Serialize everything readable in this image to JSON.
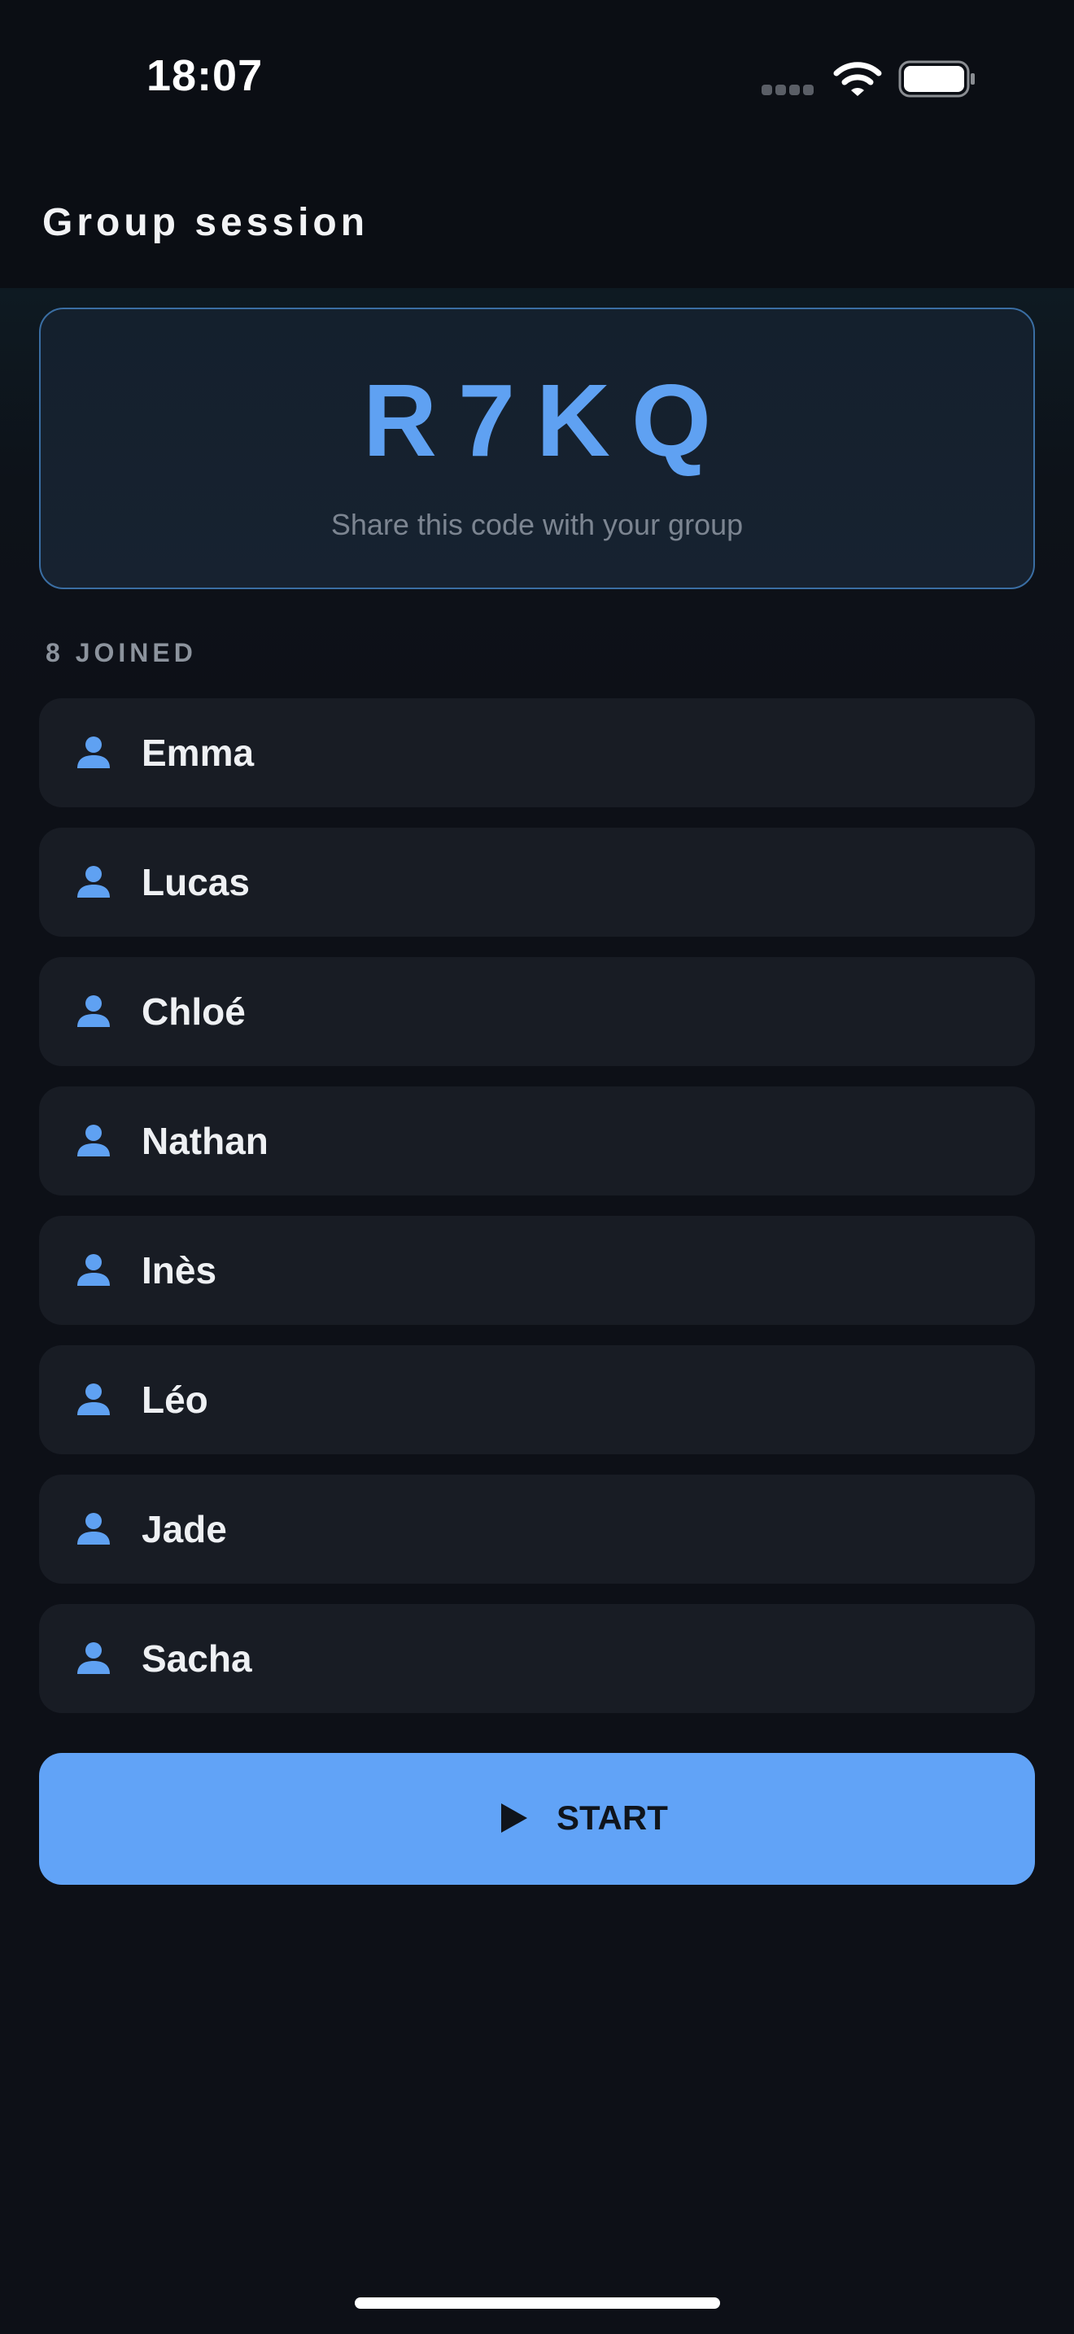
{
  "status_bar": {
    "time": "18:07",
    "signal_icon": "cellular-signal-icon",
    "wifi_icon": "wifi-icon",
    "battery_icon": "battery-icon"
  },
  "header": {
    "title": "Group session"
  },
  "session": {
    "code": "R7KQ",
    "hint": "Share this code with your group"
  },
  "members": {
    "count_label": "8 JOINED",
    "icon": "person-icon",
    "items": [
      {
        "name": "Emma"
      },
      {
        "name": "Lucas"
      },
      {
        "name": "Chloé"
      },
      {
        "name": "Nathan"
      },
      {
        "name": "Inès"
      },
      {
        "name": "Léo"
      },
      {
        "name": "Jade"
      },
      {
        "name": "Sacha"
      }
    ]
  },
  "actions": {
    "start_label": "START",
    "start_icon": "play-icon"
  },
  "colors": {
    "accent": "#61a3f7",
    "background": "#0d1017",
    "card": "#181c24"
  }
}
